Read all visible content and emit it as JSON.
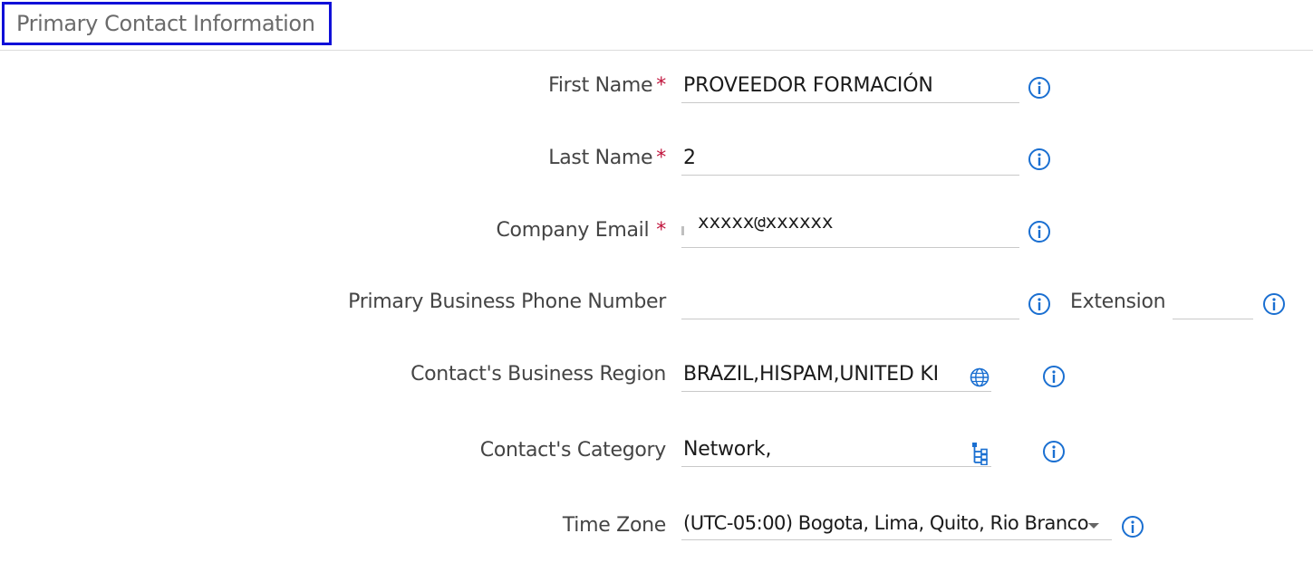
{
  "section": {
    "title": "Primary Contact Information"
  },
  "fields": {
    "first_name": {
      "label": "First Name",
      "required": "*",
      "value": "PROVEEDOR FORMACIÓN"
    },
    "last_name": {
      "label": "Last Name",
      "required": "*",
      "value": "2"
    },
    "company_email": {
      "label": "Company Email",
      "required": "*",
      "value": "xxxxx@xxxxxx"
    },
    "phone": {
      "label": "Primary Business Phone Number",
      "value": ""
    },
    "extension": {
      "label": "Extension",
      "value": ""
    },
    "business_region": {
      "label": "Contact's Business Region",
      "value": "BRAZIL,HISPAM,UNITED KI",
      "icon": "globe-icon"
    },
    "category": {
      "label": "Contact's Category",
      "value": "Network,",
      "icon": "tree-icon"
    },
    "time_zone": {
      "label": "Time Zone",
      "value": "(UTC-05:00) Bogota, Lima, Quito, Rio Branco",
      "icon": "caret-down-icon"
    }
  },
  "colors": {
    "accent": "#1a6fd1",
    "required": "#c0143c",
    "highlight_border": "#1010d8"
  }
}
